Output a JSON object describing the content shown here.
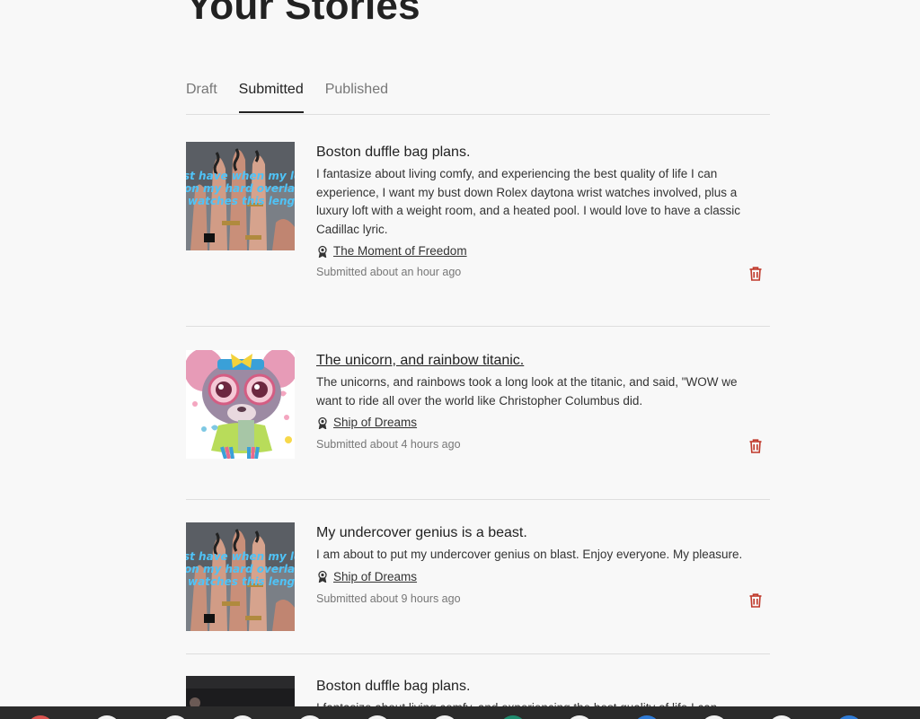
{
  "page": {
    "title": "Your Stories"
  },
  "tabs": [
    {
      "label": "Draft",
      "active": false
    },
    {
      "label": "Submitted",
      "active": true
    },
    {
      "label": "Published",
      "active": false
    }
  ],
  "stories": [
    {
      "title": "Boston duffle bag plans.",
      "text": "I fantasize about living comfy, and experiencing the best quality of life I can experience, I want my bust down Rolex daytona wrist watches involved, plus a luxury loft with a weight room, and a heated pool. I would love to have a classic Cadillac lyric.",
      "prompt": "The Moment of Freedom",
      "status": "Submitted about an hour ago",
      "thumb_text": [
        "st have when my len",
        "on my hard overlay",
        "watches this length"
      ],
      "thumb": "nails-photo"
    },
    {
      "title": "The unicorn, and rainbow titanic.",
      "text": "The unicorns, and rainbows took a long look at the titanic, and said, \"WOW we want to ride all over the world like Christopher Columbus did.",
      "prompt": "Ship of Dreams",
      "status": "Submitted about 4 hours ago",
      "thumb": "cartoon-character"
    },
    {
      "title": "My undercover genius is a beast.",
      "text": "I am about to put my undercover genius on blast. Enjoy everyone. My pleasure.",
      "prompt": "Ship of Dreams",
      "status": "Submitted about 9 hours ago",
      "thumb_text": [
        "st have when my len",
        "on my hard overlay",
        "watches this length"
      ],
      "thumb": "nails-photo"
    },
    {
      "title": "Boston duffle bag plans.",
      "text": "I fantasize about living comfy, and experiencing the best quality of life I can",
      "thumb": "dark-photo"
    }
  ],
  "colors": {
    "accent_delete": "#c0392b",
    "thumb_text": "#4fc3f7",
    "taskbar": "#2b2b2b"
  },
  "icons": {
    "prompt": "award-ribbon-icon",
    "delete": "trash-icon"
  }
}
